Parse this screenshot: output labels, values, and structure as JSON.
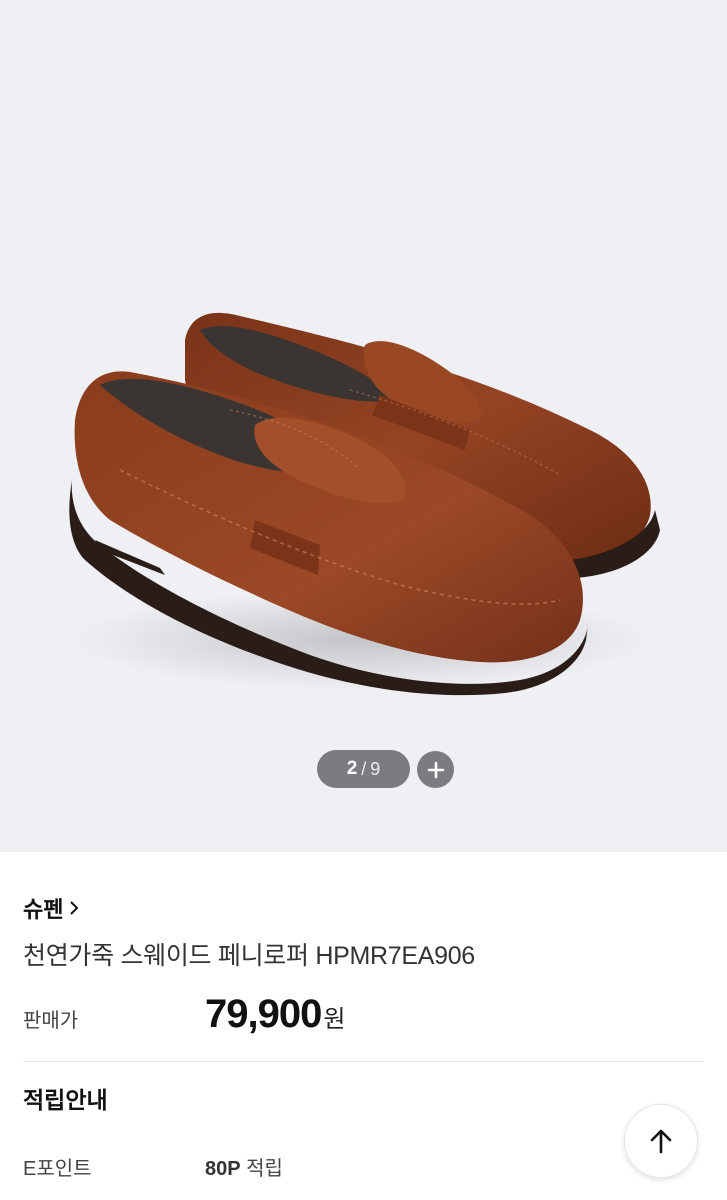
{
  "gallery": {
    "image_alt": "brown suede penny loafers",
    "pager": {
      "current": "2",
      "separator": "/",
      "total": "9"
    },
    "zoom_icon": "plus-icon"
  },
  "product": {
    "brand": "슈펜",
    "brand_chevron_icon": "chevron-right-icon",
    "title": "천연가죽 스웨이드 페니로퍼 HPMR7EA906",
    "price_label": "판매가",
    "price_value": "79,900",
    "price_unit": "원"
  },
  "points": {
    "title": "적립안내",
    "e_point_label": "E포인트",
    "e_point_value": "80P",
    "e_point_suffix": "적립"
  },
  "scroll_top_icon": "arrow-up-icon",
  "colors": {
    "gallery_bg": "#eef0f3",
    "suede": "#8b3d1e",
    "sole": "#2a1d18",
    "pager_bg": "#7a7c80"
  }
}
